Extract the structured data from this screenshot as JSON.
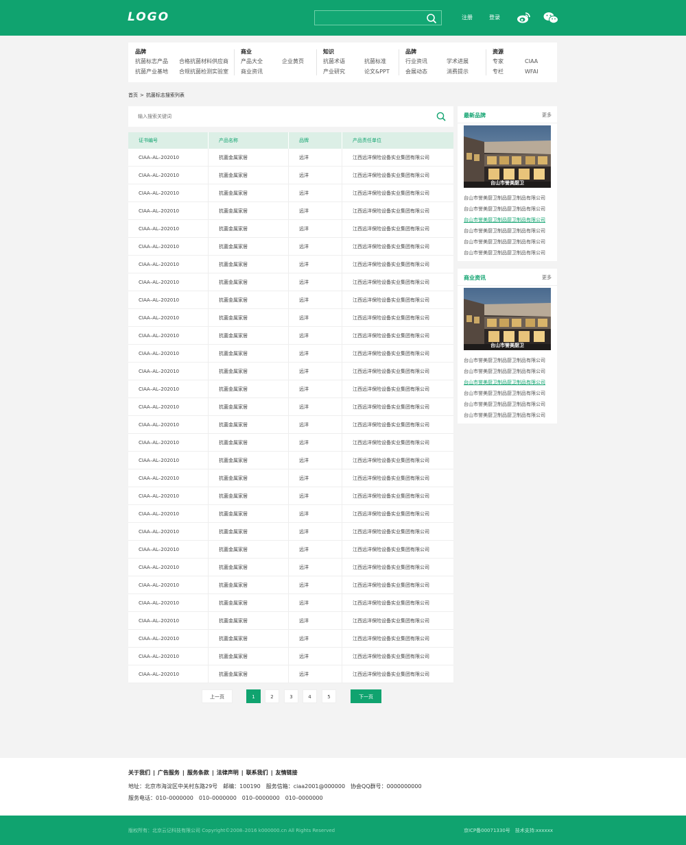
{
  "header": {
    "logo": "LOGO",
    "search_placeholder": "",
    "register": "注册",
    "login": "登录",
    "social": [
      "weibo-icon",
      "wechat-icon"
    ]
  },
  "nav": {
    "cols": [
      {
        "title": "品牌",
        "rows": [
          [
            "抗菌标志产品",
            "合格抗菌材料供应商"
          ],
          [
            "抗菌产业基地",
            "合规抗菌检测实验室"
          ]
        ]
      },
      {
        "title": "商业",
        "rows": [
          [
            "产品大全",
            "企业黄页"
          ],
          [
            "商业资讯",
            ""
          ]
        ]
      },
      {
        "title": "知识",
        "rows": [
          [
            "抗菌术语",
            "抗菌标准"
          ],
          [
            "产业研究",
            "论文&PPT"
          ]
        ]
      },
      {
        "title": "品牌",
        "rows": [
          [
            "行业资讯",
            "学术进展"
          ],
          [
            "会展动态",
            "消费提示"
          ]
        ]
      },
      {
        "title": "资源",
        "rows": [
          [
            "专家",
            "CIAA"
          ],
          [
            "专栏",
            "WFAI"
          ]
        ]
      }
    ]
  },
  "breadcrumb": [
    "首页",
    ">",
    "抗菌标志搜索列表"
  ],
  "list_search": {
    "placeholder": "输入搜索关键词"
  },
  "table": {
    "headers": [
      "证书编号",
      "产品名称",
      "品牌",
      "产品责任单位"
    ],
    "rows": [
      [
        "CIAA–AL–202010",
        "抗菌金属家居",
        "远洋",
        "江西远洋保险设备实业集团有限公司"
      ],
      [
        "CIAA–AL–202010",
        "抗菌金属家居",
        "远洋",
        "江西远洋保险设备实业集团有限公司"
      ],
      [
        "CIAA–AL–202010",
        "抗菌金属家居",
        "远洋",
        "江西远洋保险设备实业集团有限公司"
      ],
      [
        "CIAA–AL–202010",
        "抗菌金属家居",
        "远洋",
        "江西远洋保险设备实业集团有限公司"
      ],
      [
        "CIAA–AL–202010",
        "抗菌金属家居",
        "远洋",
        "江西远洋保险设备实业集团有限公司"
      ],
      [
        "CIAA–AL–202010",
        "抗菌金属家居",
        "远洋",
        "江西远洋保险设备实业集团有限公司"
      ],
      [
        "CIAA–AL–202010",
        "抗菌金属家居",
        "远洋",
        "江西远洋保险设备实业集团有限公司"
      ],
      [
        "CIAA–AL–202010",
        "抗菌金属家居",
        "远洋",
        "江西远洋保险设备实业集团有限公司"
      ],
      [
        "CIAA–AL–202010",
        "抗菌金属家居",
        "远洋",
        "江西远洋保险设备实业集团有限公司"
      ],
      [
        "CIAA–AL–202010",
        "抗菌金属家居",
        "远洋",
        "江西远洋保险设备实业集团有限公司"
      ],
      [
        "CIAA–AL–202010",
        "抗菌金属家居",
        "远洋",
        "江西远洋保险设备实业集团有限公司"
      ],
      [
        "CIAA–AL–202010",
        "抗菌金属家居",
        "远洋",
        "江西远洋保险设备实业集团有限公司"
      ],
      [
        "CIAA–AL–202010",
        "抗菌金属家居",
        "远洋",
        "江西远洋保险设备实业集团有限公司"
      ],
      [
        "CIAA–AL–202010",
        "抗菌金属家居",
        "远洋",
        "江西远洋保险设备实业集团有限公司"
      ],
      [
        "CIAA–AL–202010",
        "抗菌金属家居",
        "远洋",
        "江西远洋保险设备实业集团有限公司"
      ],
      [
        "CIAA–AL–202010",
        "抗菌金属家居",
        "远洋",
        "江西远洋保险设备实业集团有限公司"
      ],
      [
        "CIAA–AL–202010",
        "抗菌金属家居",
        "远洋",
        "江西远洋保险设备实业集团有限公司"
      ],
      [
        "CIAA–AL–202010",
        "抗菌金属家居",
        "远洋",
        "江西远洋保险设备实业集团有限公司"
      ],
      [
        "CIAA–AL–202010",
        "抗菌金属家居",
        "远洋",
        "江西远洋保险设备实业集团有限公司"
      ],
      [
        "CIAA–AL–202010",
        "抗菌金属家居",
        "远洋",
        "江西远洋保险设备实业集团有限公司"
      ],
      [
        "CIAA–AL–202010",
        "抗菌金属家居",
        "远洋",
        "江西远洋保险设备实业集团有限公司"
      ],
      [
        "CIAA–AL–202010",
        "抗菌金属家居",
        "远洋",
        "江西远洋保险设备实业集团有限公司"
      ],
      [
        "CIAA–AL–202010",
        "抗菌金属家居",
        "远洋",
        "江西远洋保险设备实业集团有限公司"
      ],
      [
        "CIAA–AL–202010",
        "抗菌金属家居",
        "远洋",
        "江西远洋保险设备实业集团有限公司"
      ],
      [
        "CIAA–AL–202010",
        "抗菌金属家居",
        "远洋",
        "江西远洋保险设备实业集团有限公司"
      ],
      [
        "CIAA–AL–202010",
        "抗菌金属家居",
        "远洋",
        "江西远洋保险设备实业集团有限公司"
      ],
      [
        "CIAA–AL–202010",
        "抗菌金属家居",
        "远洋",
        "江西远洋保险设备实业集团有限公司"
      ],
      [
        "CIAA–AL–202010",
        "抗菌金属家居",
        "远洋",
        "江西远洋保险设备实业集团有限公司"
      ],
      [
        "CIAA–AL–202010",
        "抗菌金属家居",
        "远洋",
        "江西远洋保险设备实业集团有限公司"
      ],
      [
        "CIAA–AL–202010",
        "抗菌金属家居",
        "远洋",
        "江西远洋保险设备实业集团有限公司"
      ]
    ]
  },
  "pager": {
    "prev": "上一页",
    "pages": [
      "1",
      "2",
      "3",
      "4",
      "5"
    ],
    "active": "1",
    "next": "下一页"
  },
  "sidebar": [
    {
      "title": "最新品牌",
      "more": "更多",
      "caption": "台山市誉美厨卫",
      "items": [
        "台山市誉美厨卫制品厨卫制品有限公司",
        "台山市誉美厨卫制品厨卫制品有限公司",
        "台山市誉美厨卫制品厨卫制品有限公司",
        "台山市誉美厨卫制品厨卫制品有限公司",
        "台山市誉美厨卫制品厨卫制品有限公司",
        "台山市誉美厨卫制品厨卫制品有限公司"
      ],
      "highlight": 2
    },
    {
      "title": "商业资讯",
      "more": "更多",
      "caption": "台山市誉美厨卫",
      "items": [
        "台山市誉美厨卫制品厨卫制品有限公司",
        "台山市誉美厨卫制品厨卫制品有限公司",
        "台山市誉美厨卫制品厨卫制品有限公司",
        "台山市誉美厨卫制品厨卫制品有限公司",
        "台山市誉美厨卫制品厨卫制品有限公司",
        "台山市誉美厨卫制品厨卫制品有限公司"
      ],
      "highlight": 2
    }
  ],
  "footer": {
    "links": [
      "关于我们",
      "|",
      "广告服务",
      "|",
      "服务条款",
      "|",
      "法律声明",
      "|",
      "联系我们",
      "|",
      "友情链接"
    ],
    "address": "地址：北京市海淀区中关村东路29号　邮编：100190　服务信箱：ciaa2001@000000　协会QQ群号：0000000000",
    "phone": "服务电话：010–0000000　010–0000000　010–0000000　010–0000000",
    "copyright": "版权所有：北京云记科技有限公司 Copyright©2008–2016 k000000.cn All Rights Reserved",
    "icp": "京ICP备00071330号　技术支持:xxxxxx"
  },
  "colors": {
    "brand": "#10a36f",
    "highlight": "#10a36f"
  }
}
